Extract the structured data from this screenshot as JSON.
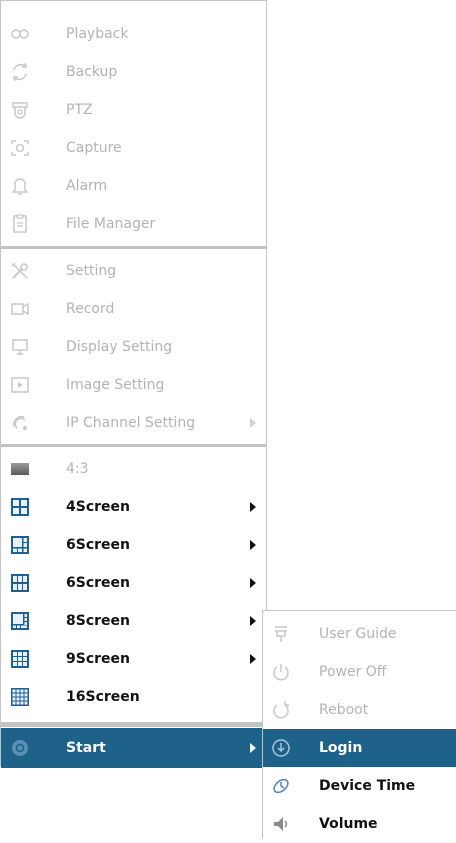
{
  "main_menu": {
    "group1": [
      {
        "label": "Playback",
        "icon": "playback-icon"
      },
      {
        "label": "Backup",
        "icon": "backup-icon"
      },
      {
        "label": "PTZ",
        "icon": "ptz-icon"
      },
      {
        "label": "Capture",
        "icon": "capture-icon"
      },
      {
        "label": "Alarm",
        "icon": "alarm-bell-icon"
      },
      {
        "label": "File Manager",
        "icon": "file-manager-icon"
      }
    ],
    "group2": [
      {
        "label": "Setting",
        "icon": "setting-tools-icon"
      },
      {
        "label": "Record",
        "icon": "record-camera-icon"
      },
      {
        "label": "Display Setting",
        "icon": "display-icon"
      },
      {
        "label": "Image Setting",
        "icon": "image-setting-icon"
      },
      {
        "label": "IP Channel Setting",
        "icon": "ip-channel-icon",
        "has_submenu": true
      }
    ],
    "group3": [
      {
        "label": "4:3",
        "icon": "aspect-ratio-icon"
      },
      {
        "label": "4Screen",
        "icon": "4screen-grid-icon",
        "has_submenu": true
      },
      {
        "label": "6Screen",
        "icon": "6screen-grid-icon",
        "has_submenu": true
      },
      {
        "label": "6Screen",
        "icon": "6screen-grid-alt-icon",
        "has_submenu": true
      },
      {
        "label": "8Screen",
        "icon": "8screen-grid-icon",
        "has_submenu": true
      },
      {
        "label": "9Screen",
        "icon": "9screen-grid-icon",
        "has_submenu": true
      },
      {
        "label": "16Screen",
        "icon": "16screen-grid-icon"
      }
    ],
    "start": {
      "label": "Start",
      "icon": "start-circle-icon",
      "has_submenu": true
    }
  },
  "sub_menu": {
    "items": [
      {
        "label": "User Guide",
        "icon": "user-guide-icon"
      },
      {
        "label": "Power Off",
        "icon": "power-icon"
      },
      {
        "label": "Reboot",
        "icon": "reboot-icon"
      },
      {
        "label": "Login",
        "icon": "login-icon"
      },
      {
        "label": "Device Time",
        "icon": "device-time-icon"
      },
      {
        "label": "Volume",
        "icon": "volume-icon"
      }
    ]
  },
  "colors": {
    "highlight": "#1e6289",
    "disabled_text": "#b3b3b3",
    "enabled_text": "#121212",
    "grid_icon_blue": "#1e5f96"
  }
}
